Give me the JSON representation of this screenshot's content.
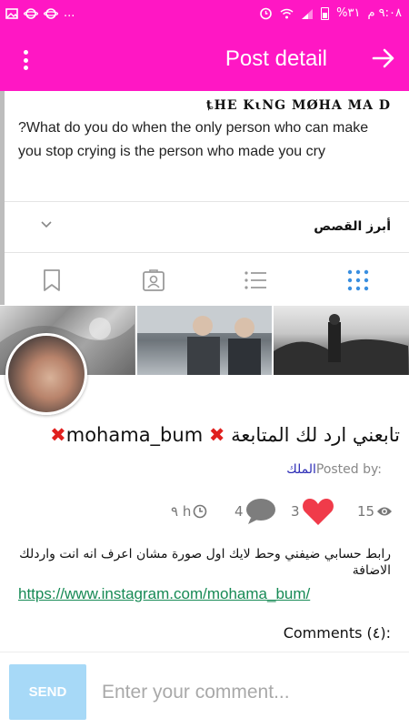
{
  "status_bar": {
    "time": "٩:٠٨ م",
    "battery_percent": "%٣١",
    "icons": [
      "battery-icon",
      "signal-icon",
      "wifi-icon",
      "alarm-icon",
      "more-dots",
      "planet-icon",
      "planet-icon",
      "gallery-icon"
    ],
    "more": "..."
  },
  "app_bar": {
    "title": "Post detail",
    "menu_icon": "kebab-menu-icon",
    "forward_icon": "arrow-right-icon",
    "background": "#ff17c4"
  },
  "post": {
    "author_header": "ȶHE KιNG MØHA MA D",
    "question": "?What do you do when the only person who can make you stop crying is the person who made you cry",
    "highlights_label": "أبرز القصص",
    "tabs": [
      "bookmark-icon",
      "contact-portrait-icon",
      "list-icon",
      "grid-icon"
    ],
    "active_tab_color": "#3a8fe0",
    "headline_arabic": "تابعني ارد لك المتابعة",
    "headline_username": "mohama_bum",
    "headline_mark": "✖",
    "posted_by_label": "Posted by:",
    "posted_by_name": "الملك",
    "stats": {
      "time": "٩ h",
      "comments": "4",
      "likes": "3",
      "views": "15"
    },
    "body_text": "رابط حسابي ضيفني وحط لايك اول صورة مشان اعرف انه انت واردلك الاضافة",
    "link": "https://www.instagram.com/mohama_bum/",
    "comments_heading": "Comments (٤):"
  },
  "composer": {
    "send_label": "SEND",
    "placeholder": "Enter your comment..."
  }
}
